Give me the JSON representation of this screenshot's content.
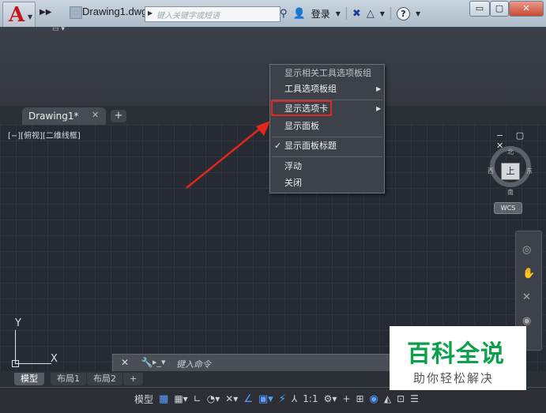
{
  "window": {
    "app_letter": "A",
    "doc_title": "Drawing1.dwg",
    "search_placeholder": "键入关键字或短语",
    "login_label": "登录",
    "help_label": "?",
    "minimize": "▭",
    "restore": "▢",
    "close": "✕"
  },
  "tabs": {
    "drawing_tab": "Drawing1*",
    "close_glyph": "✕",
    "add_glyph": "+"
  },
  "viewport": {
    "label": "[−][俯视][二维线框]",
    "ctrl": "− ▢ ✕",
    "compass": {
      "north": "北",
      "south": "南",
      "east": "东",
      "west": "西",
      "top": "上"
    },
    "wcs": "WCS"
  },
  "ucs": {
    "x": "X",
    "y": "Y"
  },
  "command": {
    "placeholder": "键入命令",
    "icons": "✕ 🔧"
  },
  "layout_tabs": [
    "模型",
    "布局1",
    "布局2",
    "+"
  ],
  "status": {
    "model": "模型",
    "ratio": "1:1"
  },
  "context_menu": {
    "header": "显示相关工具选项板组",
    "items": [
      {
        "label": "工具选项板组",
        "arrow": "▶",
        "check": ""
      },
      {
        "label": "显示选项卡",
        "arrow": "▶",
        "check": ""
      },
      {
        "label": "显示面板",
        "arrow": "",
        "check": ""
      },
      {
        "label": "显示面板标题",
        "arrow": "",
        "check": "✓"
      },
      {
        "label": "浮动",
        "arrow": "",
        "check": ""
      },
      {
        "label": "关闭",
        "arrow": "",
        "check": ""
      }
    ]
  },
  "watermark": {
    "title": "百科全说",
    "subtitle": "助你轻松解决"
  },
  "colors": {
    "accent_red": "#e4261d",
    "canvas_bg": "#262a33",
    "watermark_green": "#0aa14a"
  }
}
